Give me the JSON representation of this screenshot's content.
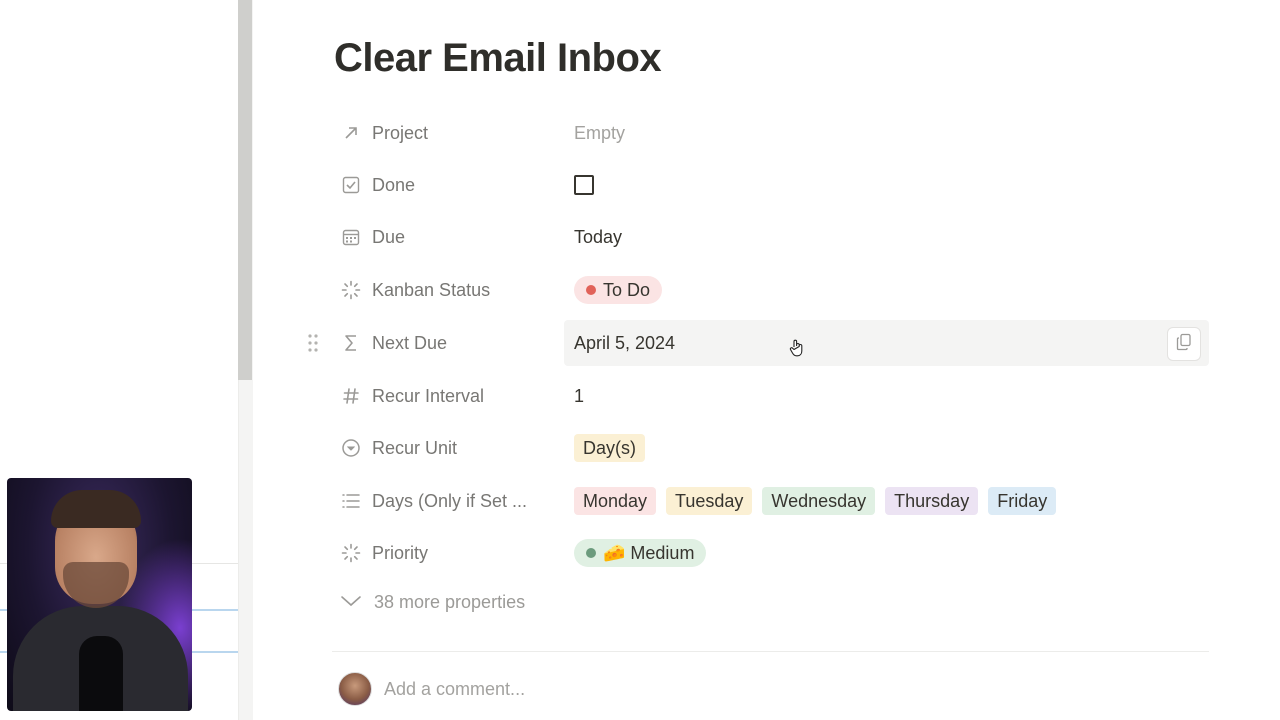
{
  "page": {
    "title": "Clear Email Inbox"
  },
  "properties": [
    {
      "label": "Project",
      "icon": "arrow-up-right-icon",
      "value": "Empty",
      "kind": "empty"
    },
    {
      "label": "Done",
      "icon": "checkbox-icon",
      "value": "",
      "kind": "checkbox",
      "checked": false
    },
    {
      "label": "Due",
      "icon": "calendar-icon",
      "value": "Today",
      "kind": "text"
    },
    {
      "label": "Kanban Status",
      "icon": "status-icon",
      "value": "To Do",
      "kind": "status"
    },
    {
      "label": "Next Due",
      "icon": "sigma-icon",
      "value": "April 5, 2024",
      "kind": "formula"
    },
    {
      "label": "Recur Interval",
      "icon": "hash-icon",
      "value": "1",
      "kind": "text"
    },
    {
      "label": "Recur Unit",
      "icon": "select-icon",
      "value": "Day(s)",
      "kind": "select"
    },
    {
      "label": "Days (Only if Set ...",
      "icon": "list-icon",
      "kind": "multi-select",
      "tags": [
        "Monday",
        "Tuesday",
        "Wednesday",
        "Thursday",
        "Friday"
      ]
    },
    {
      "label": "Priority",
      "icon": "status-icon",
      "value": "🧀 Medium",
      "kind": "status"
    }
  ],
  "more_properties": "38 more properties",
  "comment": {
    "placeholder": "Add a comment..."
  },
  "colors": {
    "todo_bg": "#fbe4e4",
    "todo_dot": "#e16259",
    "unit_bg": "#fbf0d4",
    "monday_bg": "#fbe4e4",
    "tuesday_bg": "#fbf0d4",
    "wednesday_bg": "#e0f0e3",
    "thursday_bg": "#ece3f3",
    "friday_bg": "#dcebf6",
    "medium_bg": "#e0f0e3",
    "medium_dot": "#6c9b7d"
  }
}
